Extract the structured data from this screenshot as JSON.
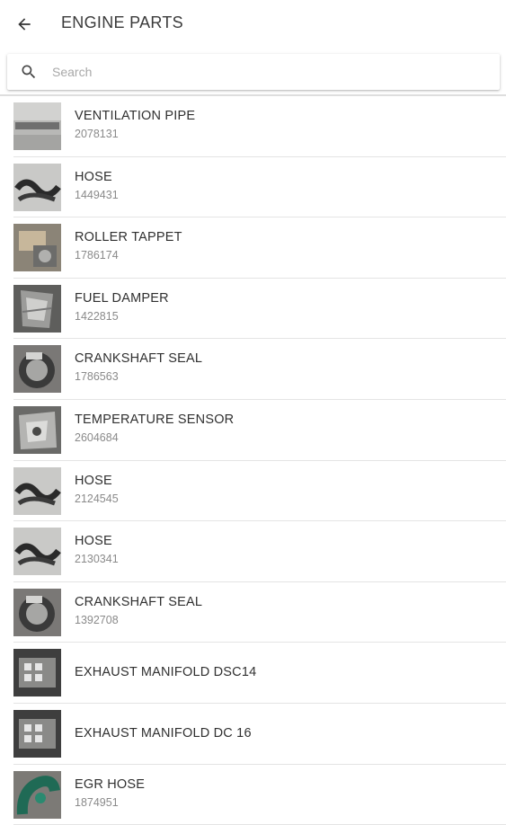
{
  "header": {
    "title": "ENGINE PARTS",
    "back_icon": "arrow-back-icon"
  },
  "search": {
    "placeholder": "Search",
    "value": "",
    "icon": "search-icon"
  },
  "colors": {
    "background": "#ffffff",
    "divider": "#e4e4e4",
    "title_text": "#3a3a3a",
    "secondary_text": "#8a8a8a"
  },
  "parts": [
    {
      "name": "VENTILATION PIPE",
      "number": "2078131",
      "thumb": "ventilation-pipe-photo"
    },
    {
      "name": "HOSE",
      "number": "1449431",
      "thumb": "hose-photo"
    },
    {
      "name": "ROLLER TAPPET",
      "number": "1786174",
      "thumb": "roller-tappet-photo"
    },
    {
      "name": "FUEL DAMPER",
      "number": "1422815",
      "thumb": "fuel-damper-photo"
    },
    {
      "name": "CRANKSHAFT SEAL",
      "number": "1786563",
      "thumb": "crankshaft-seal-photo"
    },
    {
      "name": "TEMPERATURE SENSOR",
      "number": "2604684",
      "thumb": "temperature-sensor-photo"
    },
    {
      "name": "HOSE",
      "number": "2124545",
      "thumb": "hose-photo"
    },
    {
      "name": "HOSE",
      "number": "2130341",
      "thumb": "hose-photo"
    },
    {
      "name": "CRANKSHAFT SEAL",
      "number": "1392708",
      "thumb": "crankshaft-seal-photo"
    },
    {
      "name": "EXHAUST MANIFOLD DSC14",
      "number": "",
      "thumb": "exhaust-manifold-photo"
    },
    {
      "name": "EXHAUST MANIFOLD DC 16",
      "number": "",
      "thumb": "exhaust-manifold-photo"
    },
    {
      "name": "EGR HOSE",
      "number": "1874951",
      "thumb": "egr-hose-photo"
    }
  ]
}
